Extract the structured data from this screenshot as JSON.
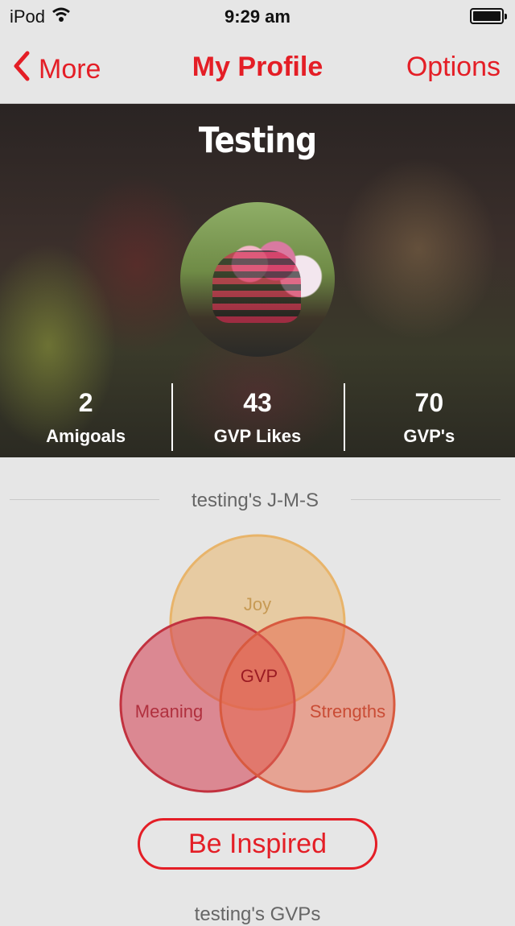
{
  "status_bar": {
    "device": "iPod",
    "time": "9:29 am"
  },
  "nav": {
    "back_label": "More",
    "title": "My Profile",
    "options_label": "Options"
  },
  "profile": {
    "name": "Testing",
    "stats": [
      {
        "value": "2",
        "label": "Amigoals"
      },
      {
        "value": "43",
        "label": "GVP Likes"
      },
      {
        "value": "70",
        "label": "GVP's"
      }
    ]
  },
  "jms": {
    "section_title": "testing's J-M-S",
    "circles": {
      "joy": "Joy",
      "meaning": "Meaning",
      "strengths": "Strengths",
      "center": "GVP"
    },
    "colors": {
      "joy": "#e8b46a",
      "meaning": "#d23b4c",
      "strengths": "#e66b4e",
      "center": "#b3202a"
    }
  },
  "actions": {
    "inspire_label": "Be Inspired"
  },
  "bottom": {
    "section_title": "testing's GVPs"
  },
  "accent_color": "#e41e26"
}
